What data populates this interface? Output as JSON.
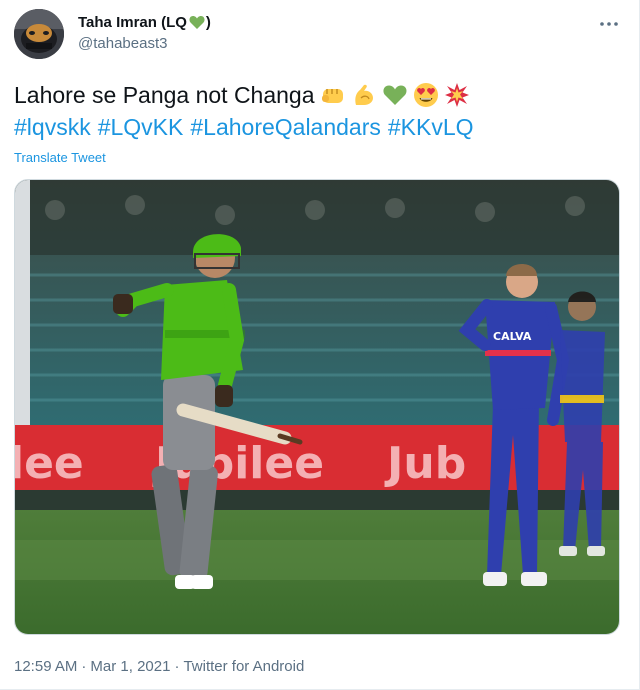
{
  "author": {
    "display_name": "Taha Imran (LQ",
    "display_name_close": ")",
    "heart_icon": "green-heart-icon",
    "handle": "@tahabeast3",
    "avatar_icon": "avatar-image"
  },
  "more_icon": "more-horizontal-icon",
  "tweet": {
    "text": "Lahore se Panga not Changa",
    "emojis": [
      "fist-icon",
      "flexed-biceps-icon",
      "green-heart-icon",
      "heart-eyes-icon",
      "collision-icon"
    ],
    "hashtags": [
      "#lqvskk",
      "#LQvKK",
      "#LahoreQalandars",
      "#KKvLQ"
    ],
    "translate_label": "Translate Tweet"
  },
  "media": {
    "banner_text_left": "lee",
    "banner_text_center": "Jubilee",
    "banner_text_right": "Jub",
    "sponsor_text": "CALVA"
  },
  "footer": {
    "time": "12:59 AM",
    "date": "Mar 1, 2021",
    "source": "Twitter for Android",
    "separator": "·"
  },
  "colors": {
    "link": "#1b95e0",
    "secondary_text": "#5b7083",
    "lahore_green": "#4cbb17",
    "karachi_blue": "#2f3fae"
  }
}
